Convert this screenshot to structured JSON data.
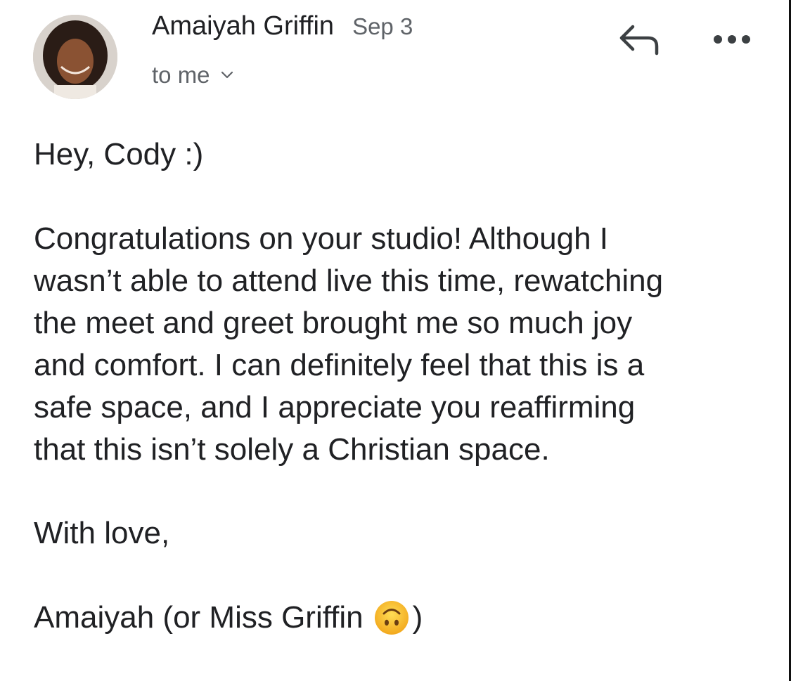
{
  "sender": {
    "name": "Amaiyah Griffin",
    "date": "Sep 3",
    "recipient": "to me"
  },
  "icons": {
    "avatar": "avatar-photo",
    "chevron": "chevron-down-icon",
    "reply": "reply-icon",
    "more": "more-options-icon",
    "emoji": "upside-down-face-emoji"
  },
  "body": {
    "greeting": "Hey, Cody :)",
    "paragraph_lines": [
      "Congratulations on your studio! Although I",
      "wasn’t able to attend live this time, rewatching",
      "the meet and greet brought me so much joy",
      "and comfort. I can definitely feel that this is a",
      "safe space, and I appreciate you reaffirming",
      "that this isn’t solely a Christian space."
    ],
    "closing": "With love,",
    "signature_before_emoji": "Amaiyah (or Miss Griffin",
    "signature_after_emoji": ")"
  },
  "colors": {
    "text_primary": "#202124",
    "text_secondary": "#5f6368",
    "icon": "#3c4043",
    "emoji_yellow": "#f7c23a"
  }
}
